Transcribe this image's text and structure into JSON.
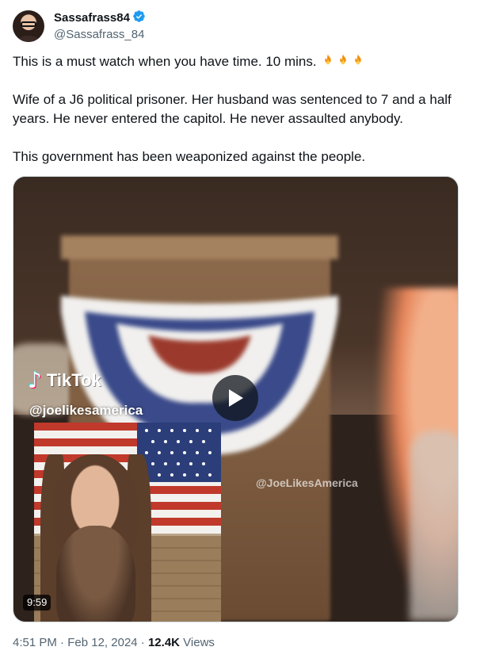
{
  "author": {
    "display_name": "Sassafrass84",
    "handle": "@Sassafrass_84",
    "verified": true,
    "verified_color": "#1d9bf0"
  },
  "tweet": {
    "paragraph_1": "This is a must watch when you have time. 10 mins.",
    "paragraph_1_emoji": [
      "fire-emoji",
      "fire-emoji",
      "fire-emoji"
    ],
    "paragraph_2": "Wife of a J6 political prisoner. Her husband was sentenced to 7 and a half years. He never entered the capitol. He never assaulted anybody.",
    "paragraph_3": "This government has been weaponized against the people."
  },
  "video": {
    "overlay_brand": "TikTok",
    "overlay_handle": "@joelikesamerica",
    "watermark": "@JoeLikesAmerica",
    "duration": "9:59"
  },
  "meta": {
    "time": "4:51 PM",
    "date": "Feb 12, 2024",
    "separator": "·",
    "views_count": "12.4K",
    "views_label": "Views"
  }
}
